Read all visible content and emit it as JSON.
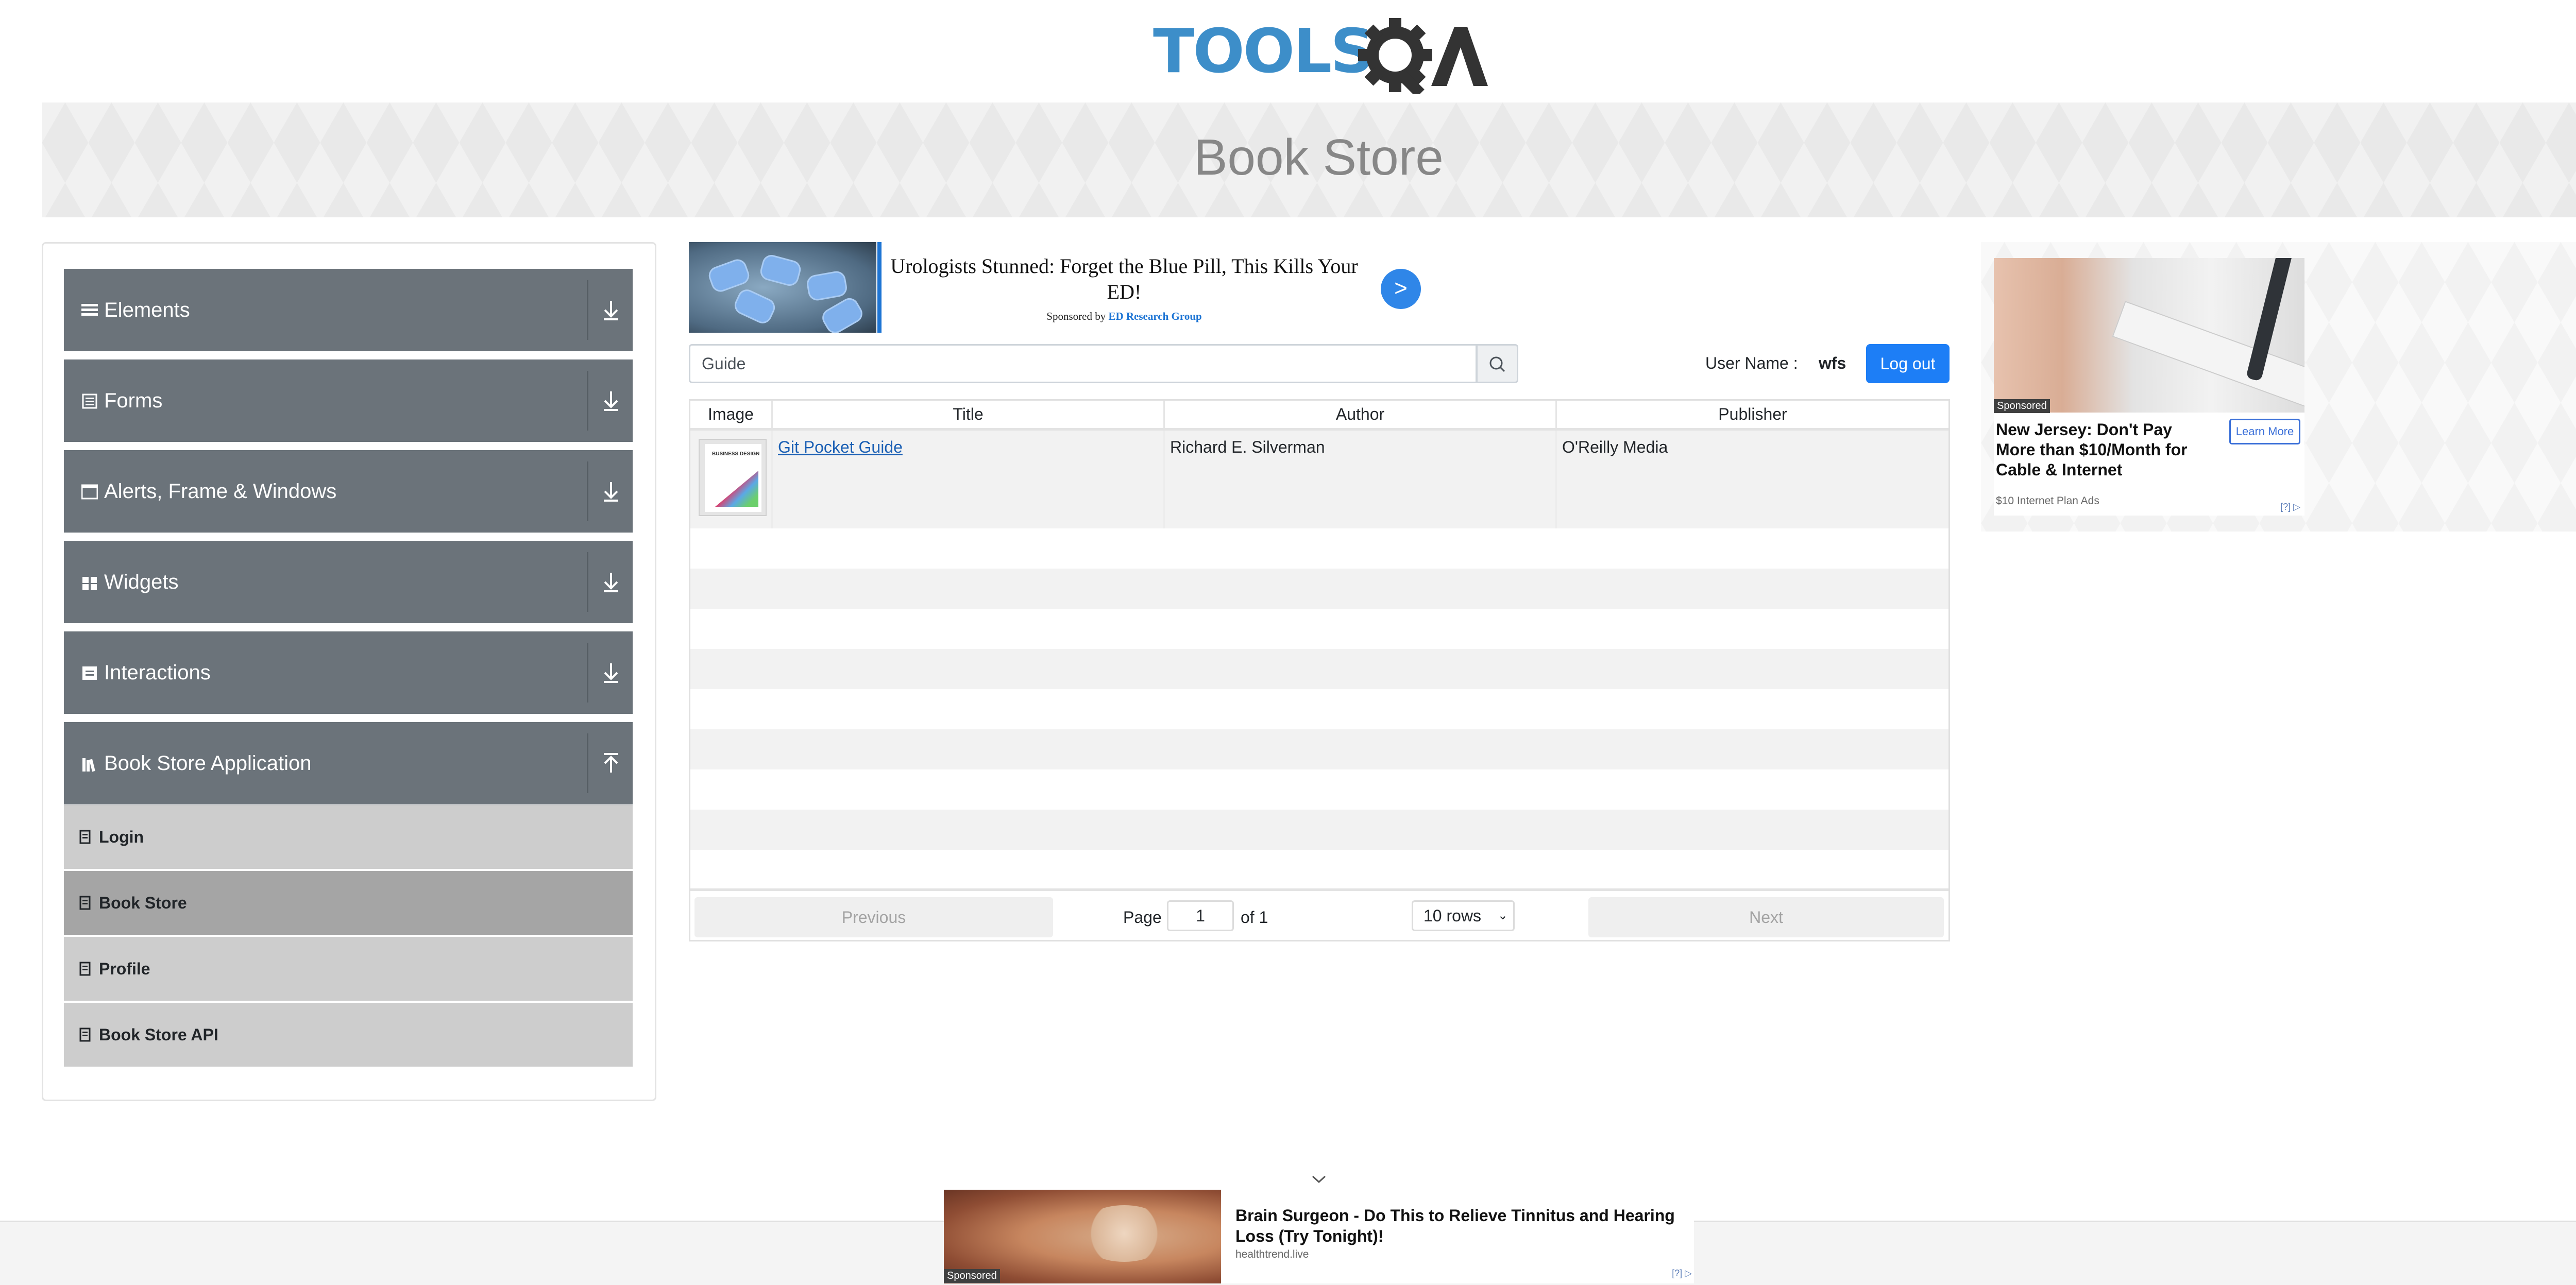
{
  "header": {
    "logo_text": "TOOLSQA",
    "page_title": "Book Store"
  },
  "sidebar": {
    "groups": [
      {
        "label": "Elements",
        "icon": "hamburger-icon"
      },
      {
        "label": "Forms",
        "icon": "list-icon"
      },
      {
        "label": "Alerts, Frame & Windows",
        "icon": "window-icon"
      },
      {
        "label": "Widgets",
        "icon": "grid-icon"
      },
      {
        "label": "Interactions",
        "icon": "interaction-icon"
      },
      {
        "label": "Book Store Application",
        "icon": "books-icon"
      }
    ],
    "subitems": [
      {
        "label": "Login",
        "active": false
      },
      {
        "label": "Book Store",
        "active": true
      },
      {
        "label": "Profile",
        "active": false
      },
      {
        "label": "Book Store API",
        "active": false
      }
    ]
  },
  "top_ad": {
    "headline": "Urologists Stunned: Forget the Blue Pill, This Kills Your ED!",
    "sponsored_prefix": "Sponsored by",
    "sponsor": "ED Research Group",
    "button": ">"
  },
  "search": {
    "value": "Guide",
    "icon": "search-icon"
  },
  "user": {
    "label": "User Name :",
    "value": "wfs",
    "logout": "Log out"
  },
  "table": {
    "columns": [
      "Image",
      "Title",
      "Author",
      "Publisher"
    ],
    "rows": [
      {
        "title": "Git Pocket Guide",
        "author": "Richard E. Silverman",
        "publisher": "O'Reilly Media",
        "cover_text": "BUSINESS DESIGN"
      }
    ],
    "empty_rows": 9
  },
  "pagination": {
    "previous": "Previous",
    "page_label": "Page",
    "page": "1",
    "of_label": "of 1",
    "rows_select": "10 rows",
    "next": "Next"
  },
  "side_ad": {
    "sponsored": "Sponsored",
    "headline": "New Jersey: Don't Pay More than $10/Month for Cable & Internet",
    "source": "$10 Internet Plan Ads",
    "button": "Learn More",
    "choice": "[?]"
  },
  "bottom_ad": {
    "sponsored": "Sponsored",
    "headline": "Brain Surgeon - Do This to Relieve Tinnitus and Hearing Loss (Try Tonight)!",
    "source": "healthtrend.live",
    "choice": "[?]"
  },
  "colors": {
    "nav_bg": "#6b737a",
    "sub_bg": "#cdcdcd",
    "sub_active": "#a5a5a5",
    "accent": "#1d7ef6",
    "logo": "#3d8ec9"
  }
}
